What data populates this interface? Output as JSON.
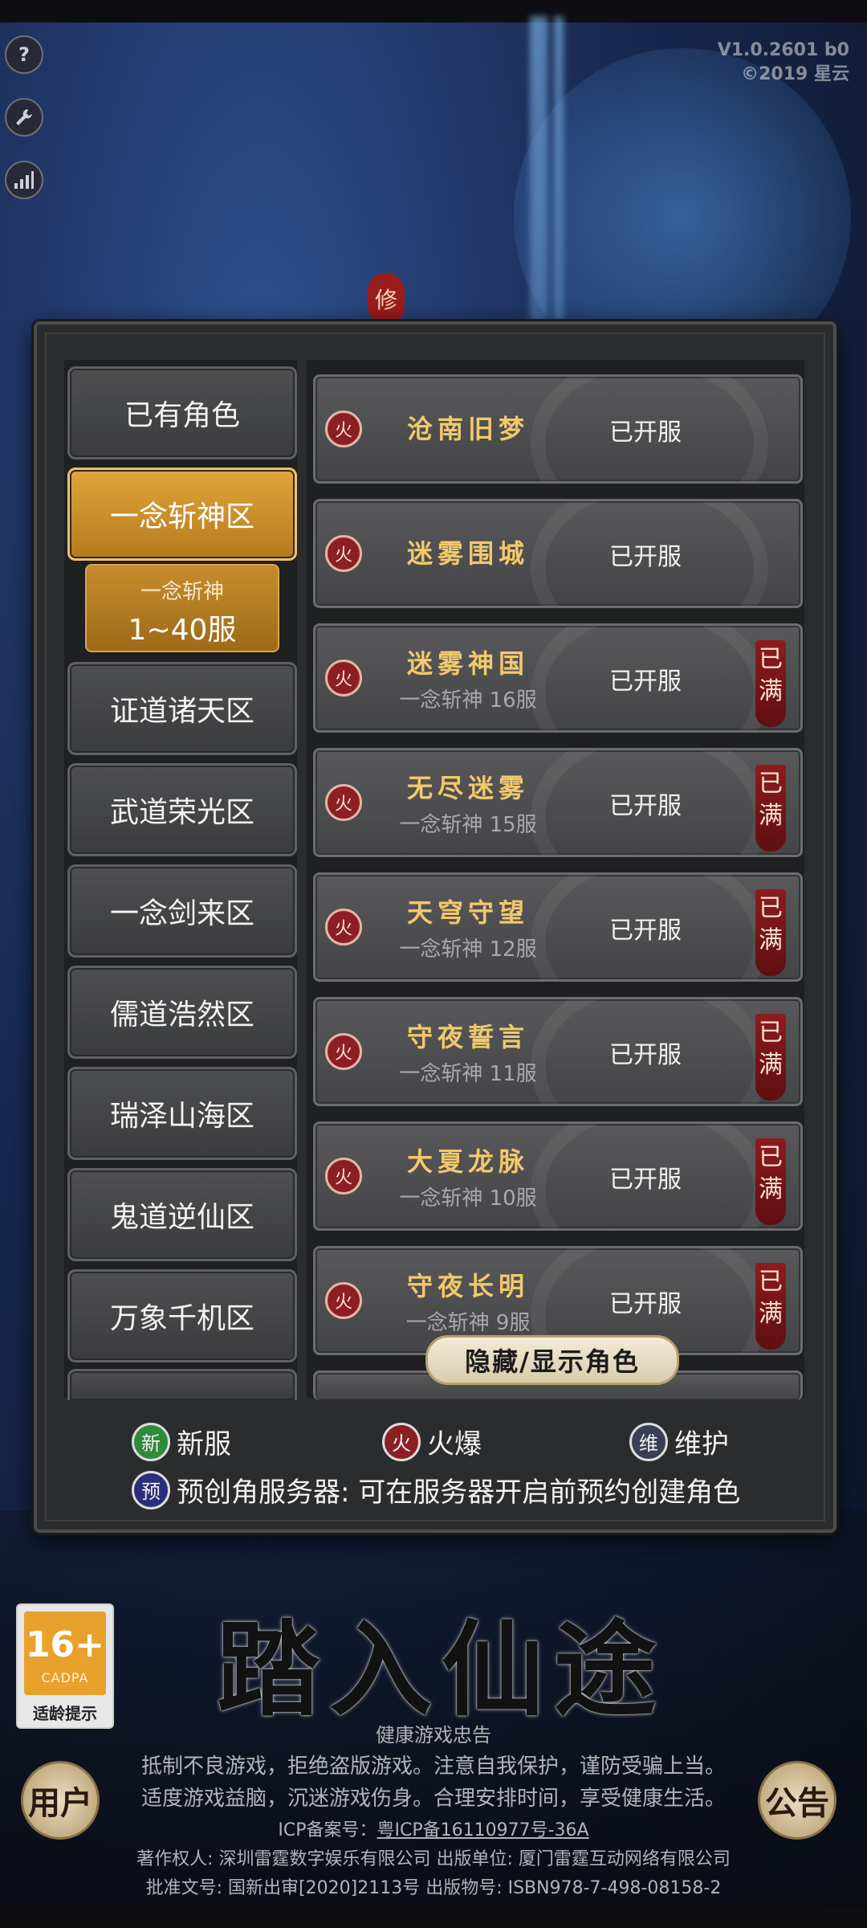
{
  "version": {
    "line1": "V1.0.2601 b0",
    "line2": "©2019 星云"
  },
  "tools": [
    "help-icon",
    "wrench-icon",
    "signal-icon"
  ],
  "background": {
    "title_fragment": "修"
  },
  "zones": [
    {
      "label": "已有角色",
      "active": false
    },
    {
      "label": "一念斩神区",
      "active": true
    },
    {
      "label": "证道诸天区",
      "active": false
    },
    {
      "label": "武道荣光区",
      "active": false
    },
    {
      "label": "一念剑来区",
      "active": false
    },
    {
      "label": "儒道浩然区",
      "active": false
    },
    {
      "label": "瑞泽山海区",
      "active": false
    },
    {
      "label": "鬼道逆仙区",
      "active": false
    },
    {
      "label": "万象千机区",
      "active": false
    }
  ],
  "sub_zone": {
    "line1": "一念斩神",
    "line2": "1~40服"
  },
  "hot_badge": "火",
  "full_tag": "已满",
  "servers": [
    {
      "name": "沧南旧梦",
      "sub": "",
      "status": "已开服",
      "full": false
    },
    {
      "name": "迷雾围城",
      "sub": "",
      "status": "已开服",
      "full": false
    },
    {
      "name": "迷雾神国",
      "sub": "一念斩神 16服",
      "status": "已开服",
      "full": true
    },
    {
      "name": "无尽迷雾",
      "sub": "一念斩神 15服",
      "status": "已开服",
      "full": true
    },
    {
      "name": "天穹守望",
      "sub": "一念斩神 12服",
      "status": "已开服",
      "full": true
    },
    {
      "name": "守夜誓言",
      "sub": "一念斩神 11服",
      "status": "已开服",
      "full": true
    },
    {
      "name": "大夏龙脉",
      "sub": "一念斩神 10服",
      "status": "已开服",
      "full": true
    },
    {
      "name": "守夜长明",
      "sub": "一念斩神 9服",
      "status": "已开服",
      "full": true
    }
  ],
  "toggle_label": "隐藏/显示角色",
  "legend": {
    "new": {
      "icon": "新",
      "label": "新服",
      "color": "#2f8a3a"
    },
    "hot": {
      "icon": "火",
      "label": "火爆",
      "color": "#8c1f24"
    },
    "maint": {
      "icon": "维",
      "label": "维护",
      "color": "#3a3e55"
    },
    "pre": {
      "icon": "预",
      "label": "预创角服务器: 可在服务器开启前预约创建角色",
      "color": "#2a2f7a"
    }
  },
  "age": {
    "num": "16+",
    "cadpa": "CADPA",
    "tip": "适龄提示"
  },
  "enter_title": "踏入仙途",
  "round_buttons": {
    "user": "用户",
    "notice": "公告"
  },
  "health": {
    "title": "健康游戏忠告",
    "line1": "抵制不良游戏，拒绝盗版游戏。注意自我保护，谨防受骗上当。",
    "line2": "适度游戏益脑，沉迷游戏伤身。合理安排时间，享受健康生活。",
    "icp_label": "ICP备案号：",
    "icp_value": "粤ICP备16110977号-36A",
    "copyright": "著作权人: 深圳雷霆数字娱乐有限公司 出版单位: 厦门雷霆互动网络有限公司",
    "approval": "批准文号: 国新出审[2020]2113号 出版物号: ISBN978-7-498-08158-2"
  }
}
